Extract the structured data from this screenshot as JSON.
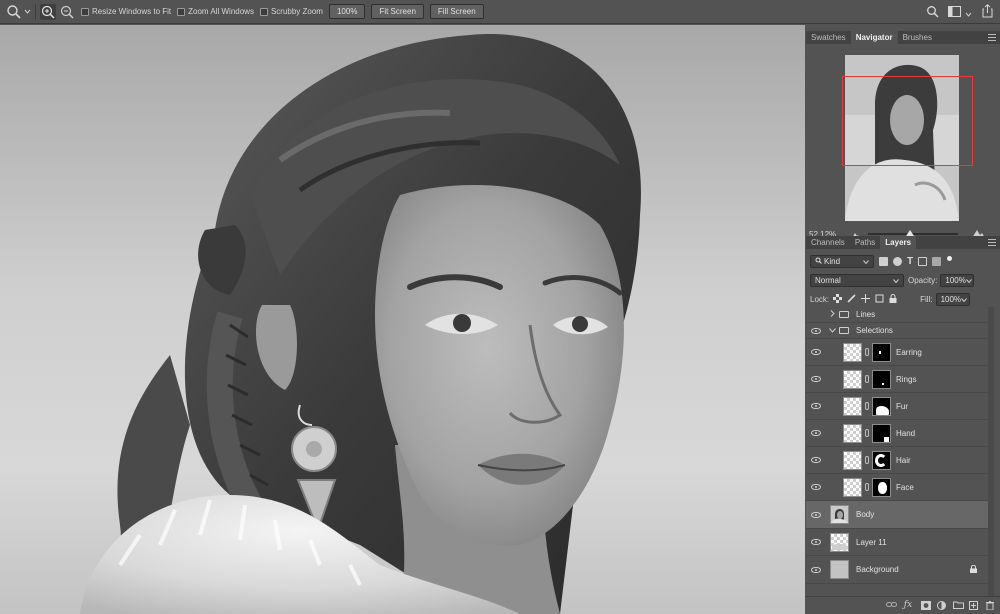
{
  "options_bar": {
    "resize_windows": "Resize Windows to Fit",
    "zoom_all": "Zoom All Windows",
    "scrubby_zoom": "Scrubby Zoom",
    "zoom_100": "100%",
    "fit_screen": "Fit Screen",
    "fill_screen": "Fill Screen"
  },
  "top_panel": {
    "tabs": [
      "Swatches",
      "Navigator",
      "Brushes"
    ],
    "active_tab": "Navigator",
    "zoom_percent": "52.12%"
  },
  "layers_panel": {
    "tabs": [
      "Channels",
      "Paths",
      "Layers"
    ],
    "active_tab": "Layers",
    "filter_kind": "Kind",
    "blend_mode": "Normal",
    "opacity_label": "Opacity:",
    "opacity_value": "100%",
    "lock_label": "Lock:",
    "fill_label": "Fill:",
    "fill_value": "100%",
    "layers": [
      {
        "name": "Lines",
        "type": "group",
        "expanded": false,
        "visible": false
      },
      {
        "name": "Selections",
        "type": "group",
        "expanded": true,
        "visible": true
      },
      {
        "name": "Earring",
        "type": "masked",
        "visible": true
      },
      {
        "name": "Rings",
        "type": "masked",
        "visible": true
      },
      {
        "name": "Fur",
        "type": "masked",
        "visible": true
      },
      {
        "name": "Hand",
        "type": "masked",
        "visible": true
      },
      {
        "name": "Hair",
        "type": "masked",
        "visible": true
      },
      {
        "name": "Face",
        "type": "masked",
        "visible": true
      },
      {
        "name": "Body",
        "type": "pixel",
        "visible": true,
        "selected": true
      },
      {
        "name": "Layer 11",
        "type": "pixel",
        "visible": true
      },
      {
        "name": "Background",
        "type": "background",
        "visible": true,
        "locked": true
      }
    ]
  },
  "colors": {
    "ui_bg": "#535353",
    "navigator_box": "#e83a3a",
    "selected_layer": "#676767"
  }
}
